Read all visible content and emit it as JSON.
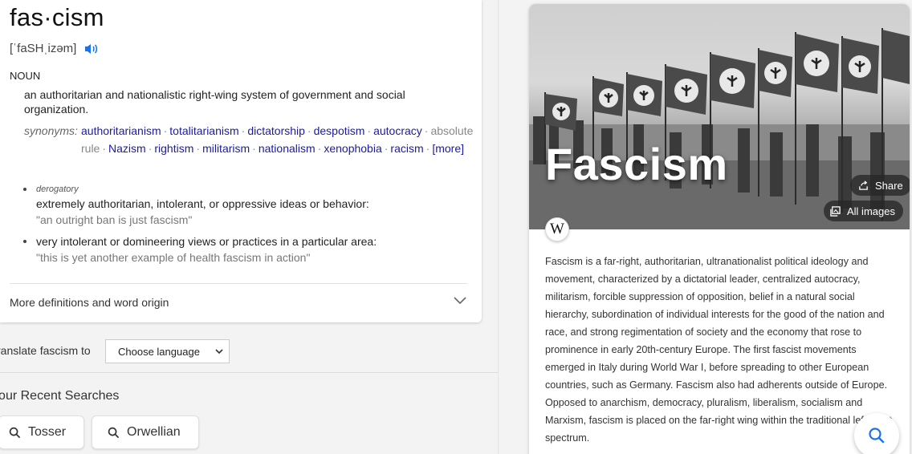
{
  "definition": {
    "word": "fas·cism",
    "pronunciation": "[ˈfaSHˌizəm]",
    "part_of_speech": "NOUN",
    "sense1": "an authoritarian and nationalistic right-wing system of government and social organization.",
    "synonyms_label": "synonyms:",
    "synonyms": [
      {
        "text": "authoritarianism",
        "link": true
      },
      {
        "text": "totalitarianism",
        "link": true
      },
      {
        "text": "dictatorship",
        "link": true
      },
      {
        "text": "despotism",
        "link": true
      },
      {
        "text": "autocracy",
        "link": true
      },
      {
        "text": "absolute rule",
        "link": false
      },
      {
        "text": "Nazism",
        "link": true
      },
      {
        "text": "rightism",
        "link": true
      },
      {
        "text": "militarism",
        "link": true
      },
      {
        "text": "nationalism",
        "link": true
      },
      {
        "text": "xenophobia",
        "link": true
      },
      {
        "text": "racism",
        "link": true
      }
    ],
    "synonyms_more": "[more]",
    "sense2_register": "derogatory",
    "sense2": "extremely authoritarian, intolerant, or oppressive ideas or behavior:",
    "sense2_example": "\"an outright ban is just fascism\"",
    "sense3": "very intolerant or domineering views or practices in a particular area:",
    "sense3_example": "\"this is yet another example of health fascism in action\"",
    "more_definitions": "More definitions and word origin"
  },
  "translate": {
    "label": "ranslate fascism to",
    "select_value": "Choose language"
  },
  "recent": {
    "title": "'our Recent Searches",
    "items": [
      "Tosser",
      "Orwellian"
    ]
  },
  "wiki": {
    "title": "Fascism",
    "share_label": "Share",
    "all_images_label": "All images",
    "logo": "W",
    "text": "Fascism is a far-right, authoritarian, ultranationalist political ideology and movement, characterized by a dictatorial leader, centralized autocracy, militarism, forcible suppression of opposition, belief in a natural social hierarchy, subordination of individual interests for the good of the nation and race, and strong regimentation of society and the economy that rose to prominence in early 20th-century Europe. The first fascist movements emerged in Italy during World War I, before spreading to other European countries, such as Germany. Fascism also had adherents outside of Europe. Opposed to anarchism, democracy, pluralism, liberalism, socialism and Marxism, fascism is placed on the far-right wing within the traditional left–right spectrum."
  },
  "icons": {
    "speaker": "speaker-icon",
    "chevron": "chevron-down-icon",
    "search": "search-icon",
    "share": "share-icon",
    "images": "images-icon"
  },
  "colors": {
    "link": "#1a1aa6",
    "muted": "#777777",
    "speaker": "#1a73e8",
    "fab_icon": "#1a73e8"
  }
}
